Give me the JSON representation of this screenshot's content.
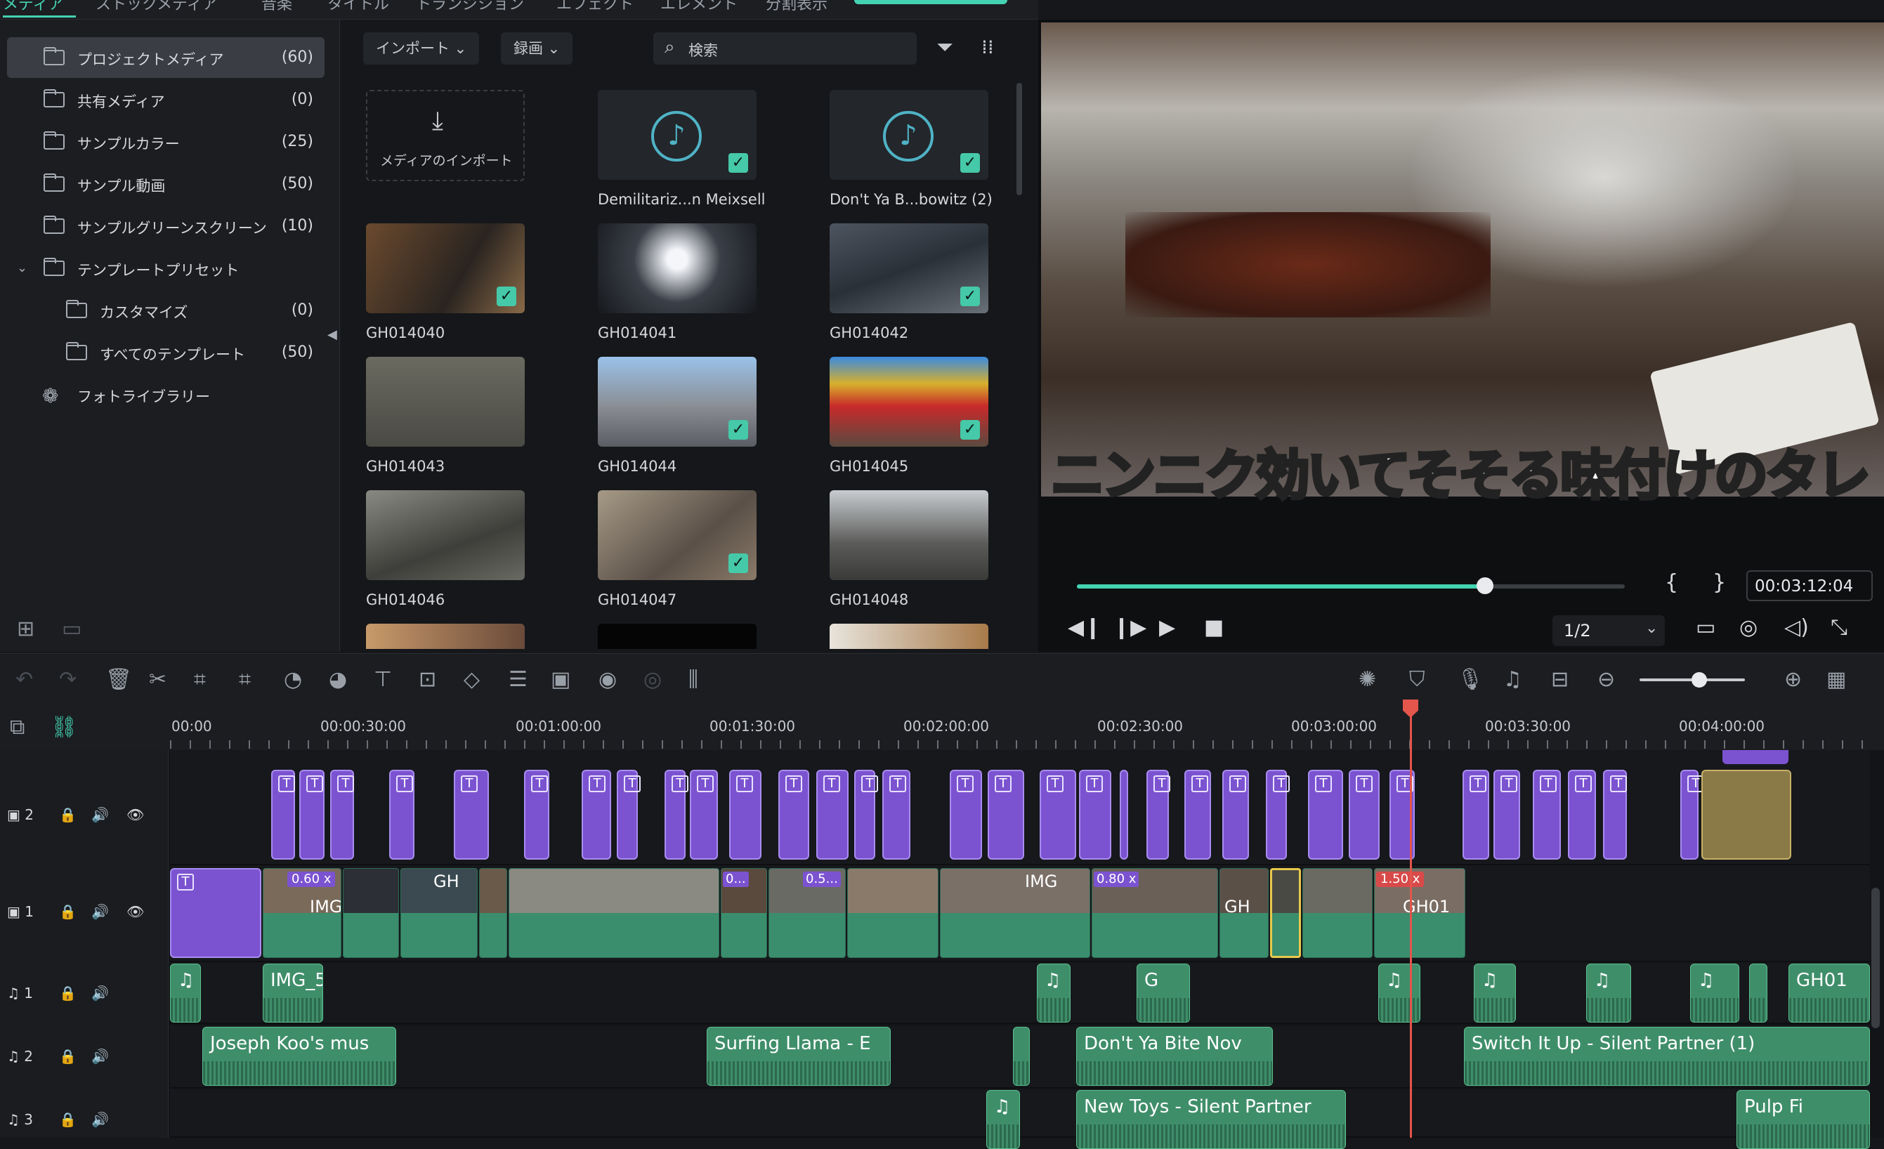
{
  "tabs": [
    "メディア",
    "ストックメディア",
    "音楽",
    "タイトル",
    "トランジション",
    "エフェクト",
    "エレメント",
    "分割表示"
  ],
  "sidebar": {
    "items": [
      {
        "label": "プロジェクトメディア",
        "count": "(60)"
      },
      {
        "label": "共有メディア",
        "count": "(0)"
      },
      {
        "label": "サンプルカラー",
        "count": "(25)"
      },
      {
        "label": "サンプル動画",
        "count": "(50)"
      },
      {
        "label": "サンプルグリーンスクリーン",
        "count": "(10)"
      },
      {
        "label": "テンプレートプリセット",
        "count": ""
      },
      {
        "label": "カスタマイズ",
        "count": "(0)"
      },
      {
        "label": "すべてのテンプレート",
        "count": "(50)"
      },
      {
        "label": "フォトライブラリー",
        "count": ""
      }
    ]
  },
  "browser": {
    "import_label": "インポート ⌄",
    "record_label": "録画 ⌄",
    "search_placeholder": "検索",
    "import_media_label": "メディアのインポート",
    "items": [
      {
        "label": "Demilitariz...n Meixsell"
      },
      {
        "label": "Don't Ya B...bowitz (2)"
      },
      {
        "label": "GH014040"
      },
      {
        "label": "GH014041"
      },
      {
        "label": "GH014042"
      },
      {
        "label": "GH014043"
      },
      {
        "label": "GH014044"
      },
      {
        "label": "GH014045"
      },
      {
        "label": "GH014046"
      },
      {
        "label": "GH014047"
      },
      {
        "label": "GH014048"
      }
    ]
  },
  "preview": {
    "subtitle": "ニンニク効いてそそる味付けのタレ",
    "timecode": "00:03:12:04",
    "progress": 0.745,
    "quality": "1/2",
    "mark_in": "{",
    "mark_out": "}"
  },
  "ruler": [
    "00:00",
    "00:00:30:00",
    "00:01:00:00",
    "00:01:30:00",
    "00:02:00:00",
    "00:02:30:00",
    "00:03:00:00",
    "00:03:30:00",
    "00:04:00:00"
  ],
  "tracks": {
    "video2": "2",
    "video1": "1",
    "audio1": "1",
    "audio2": "2",
    "audio3": "3"
  },
  "clips": {
    "speed1": "0.60 x",
    "img1": "IMG",
    "gh1": "GH",
    "speed2": "0.5...",
    "speed3": "0...",
    "img2": "IMG",
    "speed4": "0.80 x",
    "gh2": "GH",
    "speed5": "1.50 x",
    "gh3": "GH01",
    "a1_img": "IMG_5",
    "a1_g": "G",
    "a1_gh": "GH01",
    "a2_joseph": "Joseph Koo's mus",
    "a2_surf": "Surfing Llama - E",
    "a2_dont": "Don't Ya Bite Nov",
    "a2_switch": "Switch It Up - Silent Partner (1)",
    "a3_new": "New Toys - Silent Partner",
    "a3_pulp": "Pulp Fi"
  },
  "colors": {
    "accent": "#44d3b2",
    "title_clip": "#7b53d0",
    "video_clip": "#3a8e6d",
    "playhead": "#e4554c"
  }
}
